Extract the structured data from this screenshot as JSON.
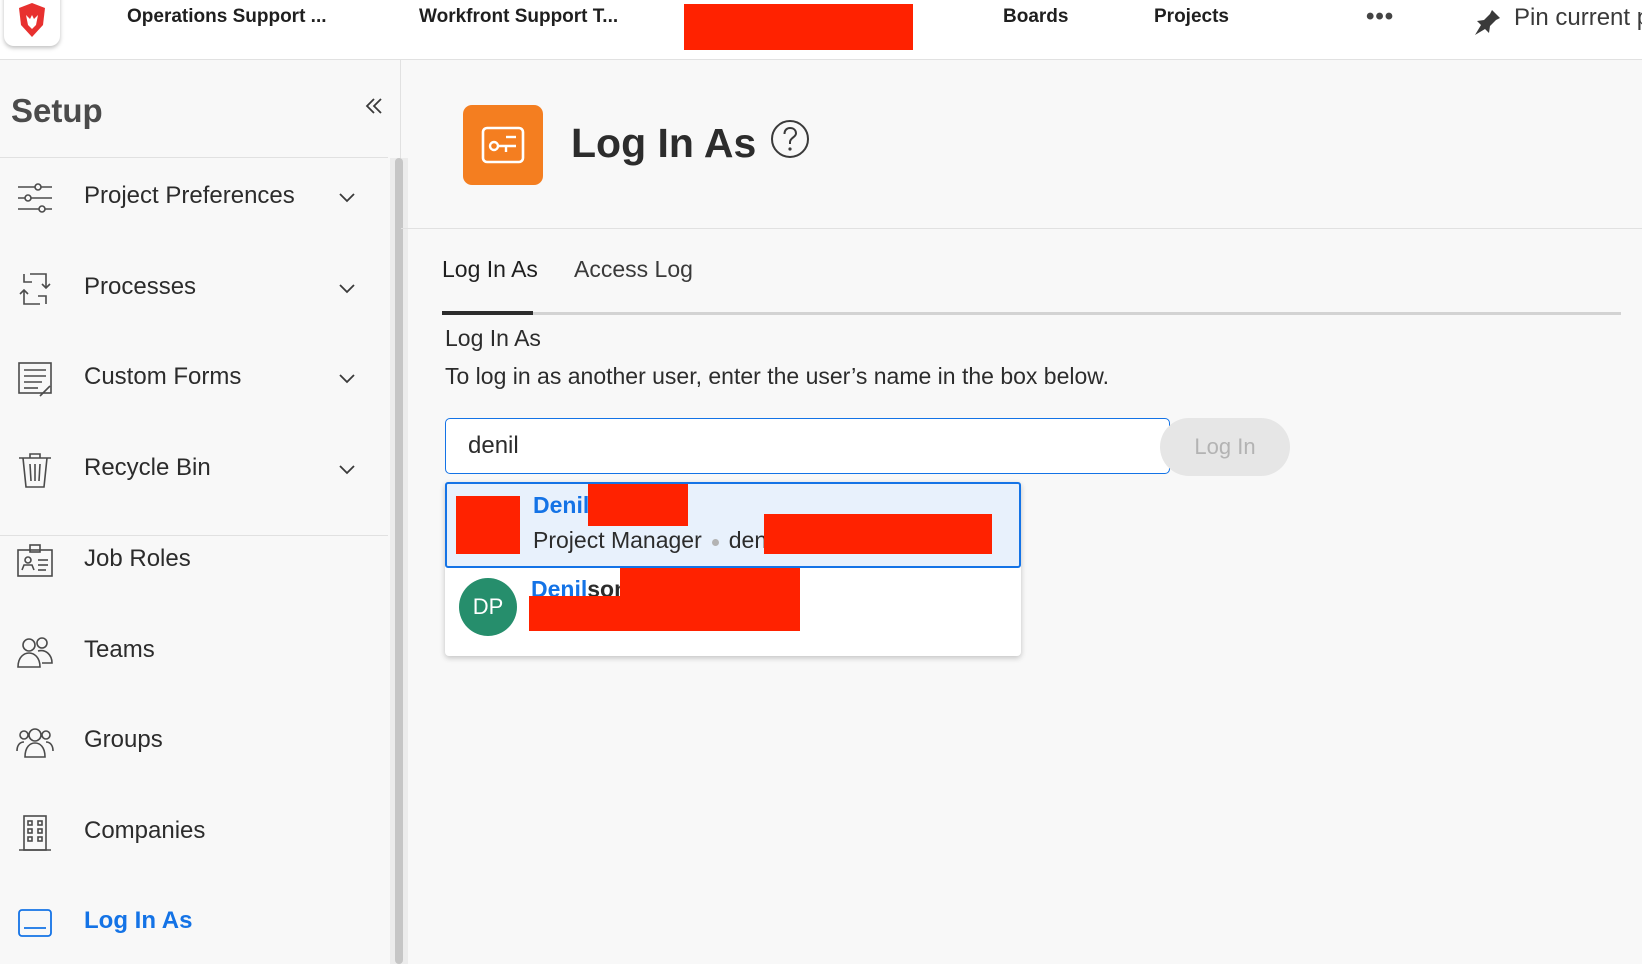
{
  "topbar": {
    "tabs": [
      "Operations Support ...",
      "Workfront Support T...",
      "Boards",
      "Projects"
    ],
    "more_label": "•••",
    "pin_label": "Pin current p"
  },
  "sidebar": {
    "title": "Setup",
    "items": [
      {
        "label": "Project Preferences",
        "icon": "sliders-icon",
        "expandable": true
      },
      {
        "label": "Processes",
        "icon": "processes-icon",
        "expandable": true
      },
      {
        "label": "Custom Forms",
        "icon": "form-icon",
        "expandable": true
      },
      {
        "label": "Recycle Bin",
        "icon": "trash-icon",
        "expandable": true
      },
      {
        "label": "Job Roles",
        "icon": "id-card-icon",
        "expandable": false
      },
      {
        "label": "Teams",
        "icon": "team-icon",
        "expandable": false
      },
      {
        "label": "Groups",
        "icon": "group-icon",
        "expandable": false
      },
      {
        "label": "Companies",
        "icon": "building-icon",
        "expandable": false
      },
      {
        "label": "Log In As",
        "icon": "login-icon",
        "expandable": false,
        "active": true
      }
    ]
  },
  "main": {
    "page_title": "Log In As",
    "tabs": [
      {
        "label": "Log In As",
        "active": true
      },
      {
        "label": "Access Log",
        "active": false
      }
    ],
    "section_title": "Log In As",
    "section_desc": "To log in as another user, enter the user’s name in the box below.",
    "search": {
      "value": "denil"
    },
    "login_button": "Log In",
    "results": [
      {
        "name_match": "Denil",
        "name_rest": "",
        "role": "Project Manager",
        "username": "denil",
        "avatar": ""
      },
      {
        "name_match": "Denil",
        "name_rest": "son",
        "role": "",
        "username": "",
        "avatar": "DP"
      }
    ]
  },
  "colors": {
    "accent": "#1473e6",
    "app_icon": "#f47e20",
    "avatar_dp": "#268e6c",
    "redaction": "#ff2200"
  }
}
